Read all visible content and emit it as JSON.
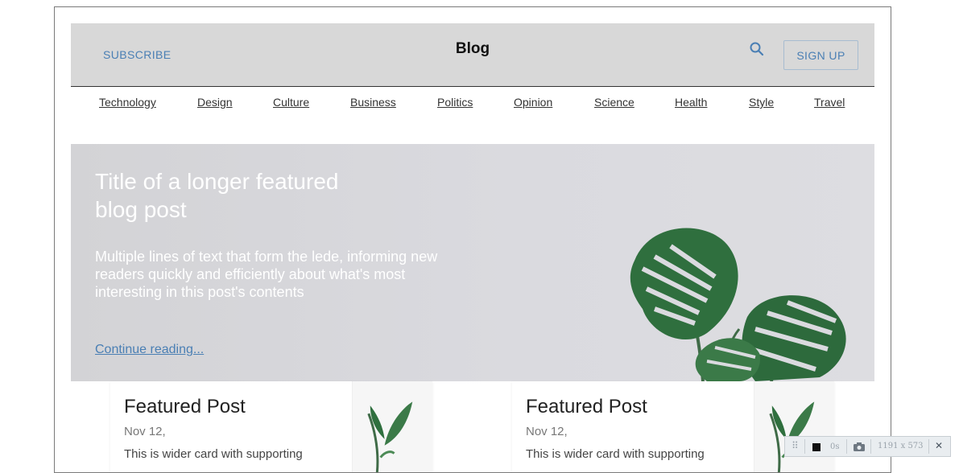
{
  "header": {
    "subscribe_label": "SUBSCRIBE",
    "brand": "Blog",
    "signup_label": "SIGN UP",
    "search_icon": "search-icon"
  },
  "nav": {
    "items": [
      "Technology",
      "Design",
      "Culture",
      "Business",
      "Politics",
      "Opinion",
      "Science",
      "Health",
      "Style",
      "Travel"
    ]
  },
  "hero": {
    "title": "Title of a longer featured blog post",
    "lede": "Multiple lines of text that form the lede, informing new readers quickly and efficiently about what's most interesting in this post's contents",
    "link_label": "Continue reading..."
  },
  "cards": [
    {
      "title": "Featured Post",
      "date": "Nov 12,",
      "text": "This is wider card with supporting"
    },
    {
      "title": "Featured Post",
      "date": "Nov 12,",
      "text": "This is wider card with supporting"
    }
  ],
  "devbar": {
    "timer": "0s",
    "size": "1191 x 573",
    "close": "✕"
  },
  "colors": {
    "accent": "#4a7fb4",
    "header_bg": "#d8d8d8",
    "hero_bg": "#d9d9dd"
  }
}
